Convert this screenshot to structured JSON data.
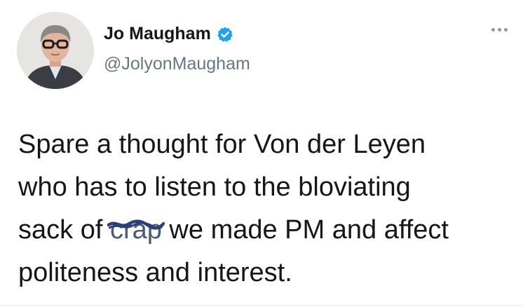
{
  "tweet": {
    "author": {
      "display_name": "Jo Maugham",
      "handle": "@JolyonMaugham",
      "verified": true
    },
    "body": {
      "line1": "Spare a thought for Von der Leyen",
      "line2": "who has to listen to the bloviating",
      "line3_before": "sack of ",
      "line3_redacted": "crap",
      "line3_after": " we made PM and affect",
      "line4": "politeness and interest."
    },
    "icons": {
      "verified": "verified-badge-icon",
      "more": "more-options-icon"
    },
    "colors": {
      "verified_blue": "#1da1f2",
      "handle_gray": "#657786",
      "scribble": "#2a3f7a"
    }
  }
}
